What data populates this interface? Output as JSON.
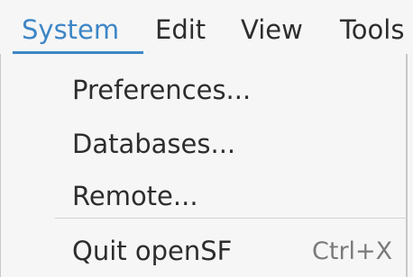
{
  "menubar": {
    "items": [
      {
        "label": "System"
      },
      {
        "label": "Edit"
      },
      {
        "label": "View"
      },
      {
        "label": "Tools"
      }
    ],
    "active_index": 0
  },
  "dropdown": {
    "items": [
      {
        "label": "Preferences..."
      },
      {
        "label": "Databases..."
      },
      {
        "label": "Remote..."
      },
      {
        "label": "Quit openSF",
        "shortcut": "Ctrl+X"
      }
    ]
  },
  "colors": {
    "active_accent": "#3d86c6",
    "menu_background": "#f6f6f6",
    "text": "#2d2d2d",
    "shortcut_text": "#7a7a7a",
    "separator": "#d4d4d4"
  }
}
